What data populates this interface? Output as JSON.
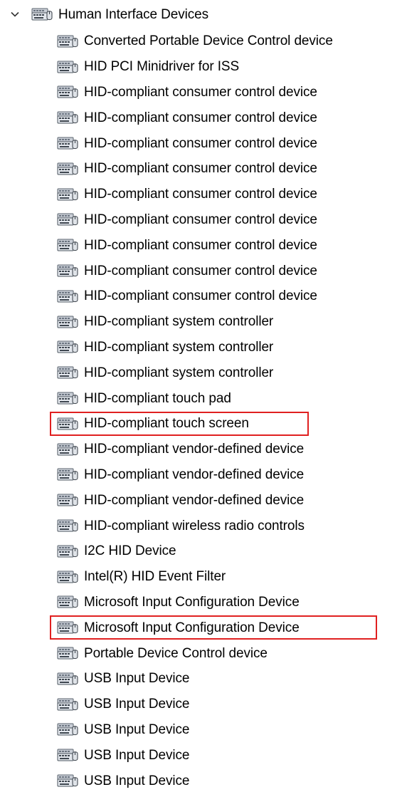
{
  "tree": {
    "category": {
      "label": "Human Interface Devices",
      "expand_icon": "chevron-down-icon",
      "icon": "hid-device-icon"
    },
    "highlight_color": "#e02020",
    "devices": [
      {
        "label": "Converted Portable Device Control device"
      },
      {
        "label": "HID PCI Minidriver for ISS"
      },
      {
        "label": "HID-compliant consumer control device"
      },
      {
        "label": "HID-compliant consumer control device"
      },
      {
        "label": "HID-compliant consumer control device"
      },
      {
        "label": "HID-compliant consumer control device"
      },
      {
        "label": "HID-compliant consumer control device"
      },
      {
        "label": "HID-compliant consumer control device"
      },
      {
        "label": "HID-compliant consumer control device"
      },
      {
        "label": "HID-compliant consumer control device"
      },
      {
        "label": "HID-compliant consumer control device"
      },
      {
        "label": "HID-compliant system controller"
      },
      {
        "label": "HID-compliant system controller"
      },
      {
        "label": "HID-compliant system controller"
      },
      {
        "label": "HID-compliant touch pad"
      },
      {
        "label": "HID-compliant touch screen",
        "highlighted": true
      },
      {
        "label": "HID-compliant vendor-defined device"
      },
      {
        "label": "HID-compliant vendor-defined device"
      },
      {
        "label": "HID-compliant vendor-defined device"
      },
      {
        "label": "HID-compliant wireless radio controls"
      },
      {
        "label": "I2C HID Device"
      },
      {
        "label": "Intel(R) HID Event Filter"
      },
      {
        "label": "Microsoft Input Configuration Device"
      },
      {
        "label": "Microsoft Input Configuration Device",
        "highlighted": true
      },
      {
        "label": "Portable Device Control device"
      },
      {
        "label": "USB Input Device"
      },
      {
        "label": "USB Input Device"
      },
      {
        "label": "USB Input Device"
      },
      {
        "label": "USB Input Device"
      },
      {
        "label": "USB Input Device"
      }
    ]
  }
}
